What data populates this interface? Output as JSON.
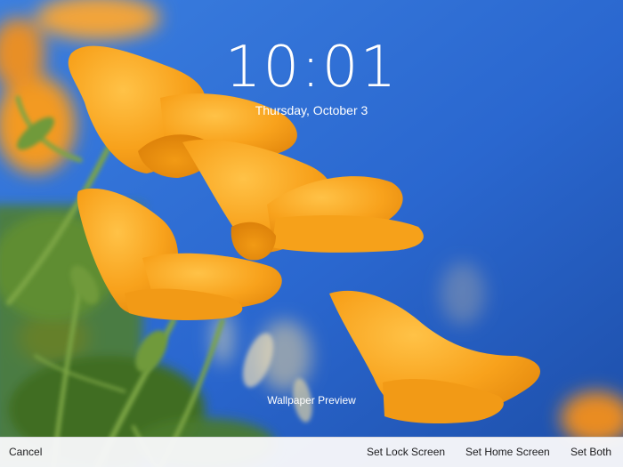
{
  "lock_screen": {
    "time": "10:01",
    "date": "Thursday, October 3"
  },
  "preview": {
    "label": "Wallpaper Preview"
  },
  "toolbar": {
    "cancel_label": "Cancel",
    "set_lock_label": "Set Lock Screen",
    "set_home_label": "Set Home Screen",
    "set_both_label": "Set Both"
  },
  "colors": {
    "sky": "#2d6fd6",
    "petal": "#f7a21b",
    "stem": "#6f9a3a",
    "toolbar_bg": "#f8f8fa",
    "toolbar_text": "#1c1c1e"
  }
}
